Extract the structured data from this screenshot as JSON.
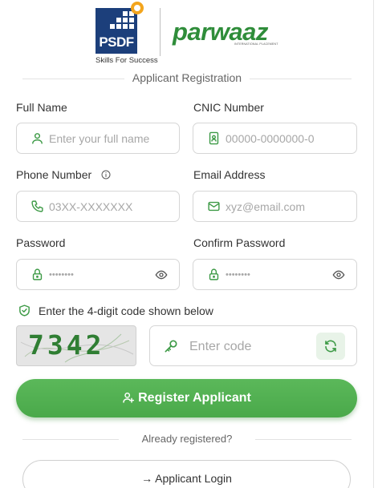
{
  "logos": {
    "psdf_text": "PSDF",
    "psdf_tagline": "Skills For Success",
    "parwaaz_text": "parwaaz",
    "parwaaz_tagline": "INTERNATIONAL PLACEMENT"
  },
  "section_title": "Applicant Registration",
  "fields": {
    "full_name": {
      "label": "Full Name",
      "placeholder": "Enter your full name",
      "icon": "user-icon"
    },
    "cnic": {
      "label": "CNIC Number",
      "placeholder": "00000-0000000-0",
      "icon": "id-card-icon"
    },
    "phone": {
      "label": "Phone Number",
      "placeholder": "03XX-XXXXXXX",
      "icon": "phone-icon"
    },
    "email": {
      "label": "Email Address",
      "placeholder": "xyz@email.com",
      "icon": "mail-icon"
    },
    "password": {
      "label": "Password",
      "placeholder": "••••••••",
      "icon": "lock-icon"
    },
    "confirm_password": {
      "label": "Confirm Password",
      "placeholder": "••••••••",
      "icon": "lock-icon"
    }
  },
  "captcha": {
    "instruction": "Enter the 4-digit code shown below",
    "code": "7342",
    "input_placeholder": "Enter code"
  },
  "actions": {
    "register_label": "Register Applicant",
    "already_text": "Already registered?",
    "login_label": "→ Applicant Login"
  },
  "colors": {
    "primary_green": "#4caf50",
    "psdf_blue": "#1c3f7b",
    "psdf_orange": "#f3a51d",
    "icon_green": "#3d9a46"
  }
}
